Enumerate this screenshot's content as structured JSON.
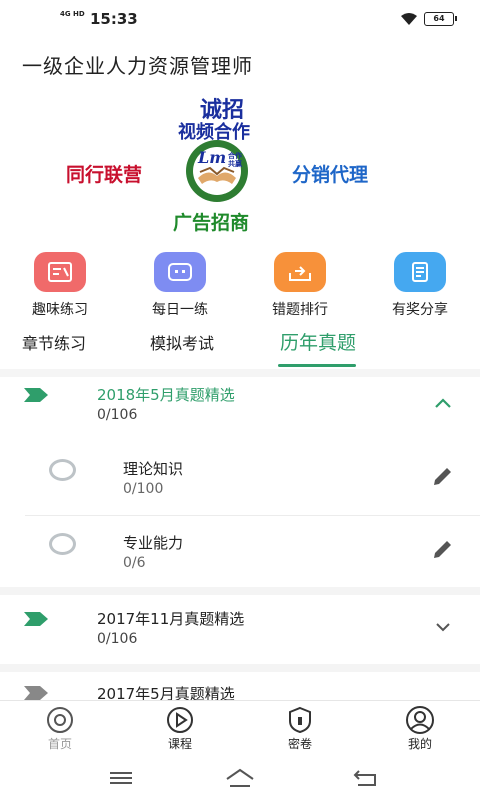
{
  "status_bar": {
    "network": "4G HD",
    "time": "15:33",
    "battery": "64"
  },
  "page_title": "一级企业人力资源管理师",
  "banner": {
    "line1": "诚招",
    "line2": "视频合作",
    "left_text": "同行联营",
    "right_text": "分销代理",
    "bottom_text": "广告招商",
    "logo_text": "Lm",
    "logo_sub": "合作共赢"
  },
  "shortcuts": [
    {
      "label": "趣味练习",
      "icon": "fun-practice-icon",
      "color": "#f06a6a"
    },
    {
      "label": "每日一练",
      "icon": "daily-practice-icon",
      "color": "#7e8cf2"
    },
    {
      "label": "错题排行",
      "icon": "wrong-ranking-icon",
      "color": "#f7913a"
    },
    {
      "label": "有奖分享",
      "icon": "share-reward-icon",
      "color": "#45a8f0"
    }
  ],
  "tabs": [
    {
      "label": "章节练习"
    },
    {
      "label": "模拟考试"
    },
    {
      "label": "历年真题",
      "active": true
    }
  ],
  "accent_color": "#2f9e6b",
  "sections": [
    {
      "title": "2018年5月真题精选",
      "count": "0/106",
      "expanded": true,
      "items": [
        {
          "title": "理论知识",
          "count": "0/100"
        },
        {
          "title": "专业能力",
          "count": "0/6"
        }
      ]
    },
    {
      "title": "2017年11月真题精选",
      "count": "0/106",
      "expanded": false
    },
    {
      "title": "2017年5月真题精选",
      "expanded": false
    }
  ],
  "bottom_nav": [
    {
      "label": "首页",
      "icon": "home-icon"
    },
    {
      "label": "课程",
      "icon": "play-icon"
    },
    {
      "label": "密卷",
      "icon": "lock-shield-icon"
    },
    {
      "label": "我的",
      "icon": "user-icon"
    }
  ]
}
